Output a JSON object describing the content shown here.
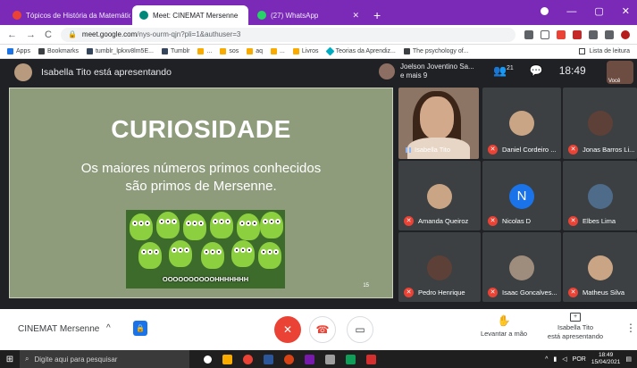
{
  "browser": {
    "tabs": [
      {
        "label": "Tópicos de História da Matemátic",
        "color": "#ea4335",
        "active": false
      },
      {
        "label": "Meet: CINEMAT Mersenne",
        "color": "#00897b",
        "active": true
      },
      {
        "label": "(27) WhatsApp",
        "color": "#25d366",
        "active": false
      }
    ],
    "url_host": "meet.google.com",
    "url_path": "/nys-ourm-qjn?pli=1&authuser=3",
    "bookmarks": [
      "Apps",
      "Bookmarks",
      "tumblr_lpkxv8lm5E...",
      "Tumblr",
      "...",
      "sos",
      "aq",
      "...",
      "Livros",
      "Teorias da Aprendiz...",
      "The psychology of..."
    ],
    "reading_list": "Lista de leitura"
  },
  "meet": {
    "presenting": "Isabella Tito está apresentando",
    "joined_line1": "Joelson Joventino Sa...",
    "joined_line2": "e mais 9",
    "participant_count": "21",
    "time": "18:49",
    "self_label": "Você"
  },
  "slide": {
    "title": "CURIOSIDADE",
    "text_line1": "Os maiores números primos conhecidos",
    "text_line2": "são primos de Mersenne.",
    "image_caption": "OOOOOOOOOOHHHHHHH",
    "page_number": "15"
  },
  "participants": {
    "speaker": "Isabella Tito",
    "tiles": [
      {
        "name": "Daniel Cordeiro ...",
        "avatar": "photo"
      },
      {
        "name": "Jonas Barros Li...",
        "avatar": "photo"
      },
      {
        "name": "Amanda Queiroz",
        "avatar": "photo"
      },
      {
        "name": "Nicolas D",
        "avatar": "N"
      },
      {
        "name": "Elbes Lima",
        "avatar": "photo"
      },
      {
        "name": "Pedro Henrique",
        "avatar": "photo"
      },
      {
        "name": "Isaac Goncalves...",
        "avatar": "photo"
      },
      {
        "name": "Matheus Silva",
        "avatar": "photo"
      }
    ]
  },
  "controls": {
    "meeting_name": "CINEMAT Mersenne",
    "raise_hand": "Levantar a mão",
    "presenter_line1": "Isabella Tito",
    "presenter_line2": "está apresentando"
  },
  "taskbar": {
    "search_placeholder": "Digite aqui para pesquisar",
    "language": "POR",
    "time": "18:49",
    "date": "15/04/2021"
  }
}
